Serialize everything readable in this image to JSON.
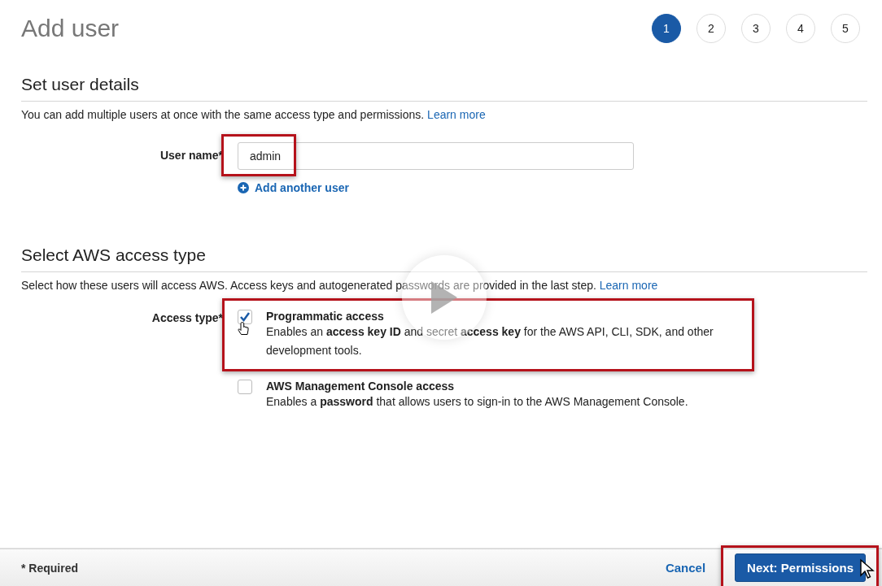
{
  "page_title": "Add user",
  "steps": [
    {
      "label": "1",
      "selected": true
    },
    {
      "label": "2",
      "selected": false
    },
    {
      "label": "3",
      "selected": false
    },
    {
      "label": "4",
      "selected": false
    },
    {
      "label": "5",
      "selected": false
    }
  ],
  "details": {
    "heading": "Set user details",
    "intro": "You can add multiple users at once with the same access type and permissions.",
    "learn_more": "Learn more",
    "user_name_label": "User name*",
    "user_name_value": "admin",
    "user_name_highlighted": true,
    "add_another": "Add another user"
  },
  "access": {
    "heading": "Select AWS access type",
    "intro": "Select how these users will access AWS. Access keys and autogenerated passwords are provided in the last step.",
    "learn_more": "Learn more",
    "label": "Access type*",
    "options": [
      {
        "title": "Programmatic access",
        "description": "Enables an **access key ID** and secret **access key** for the AWS API, CLI, SDK, and other development tools.",
        "checked": true,
        "highlighted": true
      },
      {
        "title": "AWS Management Console access",
        "description": "Enables a **password** that allows users to sign-in to the AWS Management Console.",
        "checked": false,
        "highlighted": false
      }
    ]
  },
  "footer": {
    "required_note": "* Required",
    "cancel": "Cancel",
    "next": "Next: Permissions",
    "next_highlighted": true
  }
}
